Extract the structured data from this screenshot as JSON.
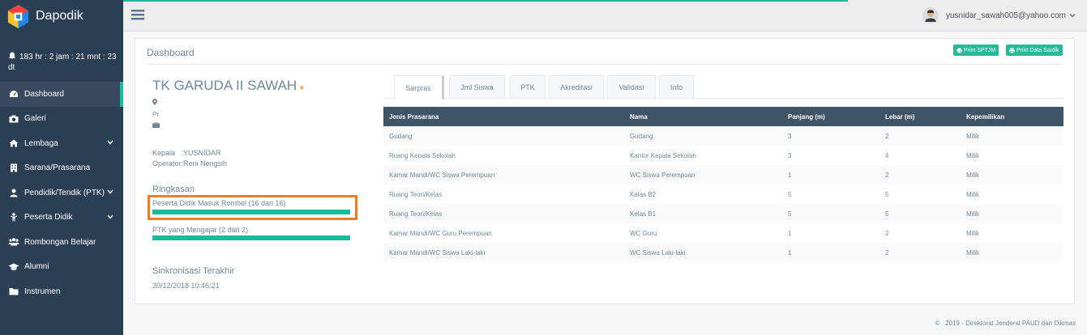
{
  "brand": {
    "name": "Dapodik"
  },
  "countdown": {
    "text": "183 hr : 2 jam : 21 mnt : 23 dt"
  },
  "menu": [
    {
      "label": "Dashboard",
      "icon": "dashboard-icon",
      "active": true
    },
    {
      "label": "Galeri",
      "icon": "camera-icon"
    },
    {
      "label": "Lembaga",
      "icon": "home-icon",
      "chevron": true
    },
    {
      "label": "Sarana/Prasarana",
      "icon": "building-icon"
    },
    {
      "label": "Pendidik/Tendik (PTK)",
      "icon": "user-icon",
      "chevron": true
    },
    {
      "label": "Peserta Didik",
      "icon": "child-icon",
      "chevron": true
    },
    {
      "label": "Rombongan Belajar",
      "icon": "users-icon"
    },
    {
      "label": "Alumni",
      "icon": "graduation-cap-icon"
    },
    {
      "label": "Instrumen",
      "icon": "folder-icon"
    }
  ],
  "topbar": {
    "user_email": "yusnidar_sawah005@yahoo.com"
  },
  "panel": {
    "title": "Dashboard",
    "print_sptjm": "Print SPTJM",
    "print_satdik": "Print Data Satdik"
  },
  "school": {
    "name": "TK GARUDA II SAWAH",
    "type": "Pr",
    "kepala": "Kepala   :YUSNIDAR",
    "operator": "Operator:Reni Nengsih"
  },
  "summary": {
    "title": "Ringkasan",
    "peserta_label": "Peserta Didik Masuk Rombel (16 dari 16)",
    "peserta_progress": 1.0,
    "ptk_label": "PTK yang Mengajar (2 dari 2)",
    "ptk_progress": 1.0
  },
  "sync": {
    "title": "Sinkronisasi Terakhir",
    "time": "30/12/2018 10:46:21"
  },
  "tabs": [
    "Sarpras",
    "Jml Siswa",
    "PTK",
    "Akreditasi",
    "Validasi",
    "Info"
  ],
  "table": {
    "headers": [
      "Jenis Prasarana",
      "Nama",
      "Panjang (m)",
      "Lebar (m)",
      "Kepemilikan"
    ],
    "rows": [
      [
        "Gudang",
        "Gudang",
        "3",
        "2",
        "Milik"
      ],
      [
        "Ruang Kepala Sekolah",
        "Kantor Kepala Sekolah",
        "3",
        "4",
        "Milik"
      ],
      [
        "Kamar Mandi/WC Siswa Perempuan",
        "WC Siswa Perempuan",
        "1",
        "2",
        "Milik"
      ],
      [
        "Ruang Teori/Kelas",
        "Kelas B2",
        "5",
        "5",
        "Milik"
      ],
      [
        "Ruang Teori/Kelas",
        "Kelas B1",
        "5",
        "5",
        "Milik"
      ],
      [
        "Kamar Mandi/WC Guru Perempuan",
        "WC Guru",
        "1",
        "2",
        "Milik"
      ],
      [
        "Kamar Mandi/WC Siswa Laki-laki",
        "WC Siswa Laki-laki",
        "1",
        "2",
        "Milik"
      ]
    ]
  },
  "footer": {
    "text": "©   2019 - Direktorat Jenderal PAUD dan Dikmas"
  },
  "colors": {
    "sidebar": "#2a3f54",
    "accent": "#1abb9c",
    "highlight": "#f47c1e",
    "table_header": "#405467"
  }
}
